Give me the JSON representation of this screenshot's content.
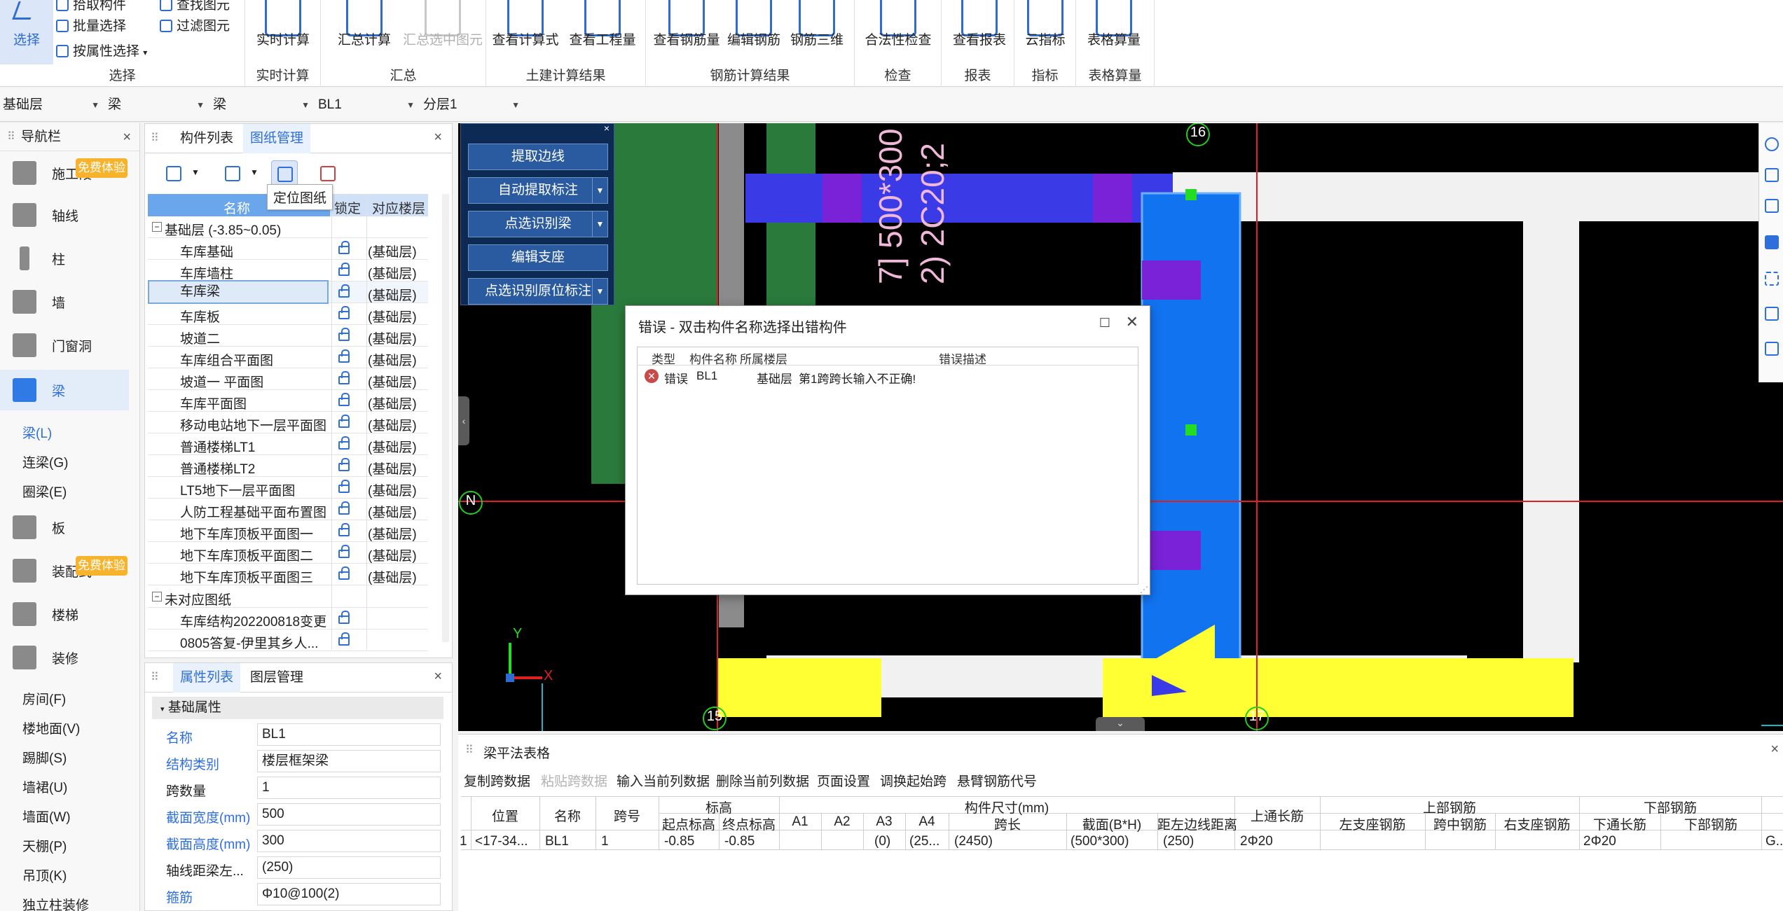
{
  "ribbon": {
    "groups": [
      {
        "title": "选择"
      },
      {
        "title": "实时计算"
      },
      {
        "title": "汇总"
      },
      {
        "title": "土建计算结果"
      },
      {
        "title": "钢筋计算结果"
      },
      {
        "title": "检查"
      },
      {
        "title": "报表"
      },
      {
        "title": "指标"
      },
      {
        "title": "表格算量"
      }
    ],
    "select_btn": "选择",
    "pick_label": "拾取构件",
    "batch_select": "批量选择",
    "attr_select": "按属性选择",
    "find_element": "查找图元",
    "filter_element": "过滤图元",
    "realtime_calc": "实时计算",
    "sum_calc": "汇总计算",
    "sum_selected": "汇总选中图元",
    "view_formula": "查看计算式",
    "view_quantity": "查看工程量",
    "view_rebar": "查看钢筋量",
    "edit_rebar": "编辑钢筋",
    "rebar_3d": "钢筋三维",
    "legality_check": "合法性检查",
    "view_report": "查看报表",
    "cloud_index": "云指标",
    "table_qty": "表格算量"
  },
  "dropbar": {
    "floor": "基础层",
    "category": "梁",
    "type": "梁",
    "element": "BL1",
    "layer": "分层1"
  },
  "nav": {
    "title": "导航栏",
    "items": [
      {
        "label": "施工段"
      },
      {
        "label": "轴线"
      },
      {
        "label": "柱"
      },
      {
        "label": "墙"
      },
      {
        "label": "门窗洞"
      },
      {
        "label": "梁"
      },
      {
        "label": "板"
      },
      {
        "label": "装配式"
      },
      {
        "label": "楼梯"
      },
      {
        "label": "装修"
      }
    ],
    "beam_subs": [
      "梁(L)",
      "连梁(G)",
      "圈梁(E)"
    ],
    "deco_subs": [
      "房间(F)",
      "楼地面(V)",
      "踢脚(S)",
      "墙裙(U)",
      "墙面(W)",
      "天棚(P)",
      "吊顶(K)",
      "独立柱装修"
    ],
    "trial_badge": "免费体验"
  },
  "drawing_panel": {
    "tab1": "构件列表",
    "tab2": "图纸管理",
    "tooltip": "定位图纸",
    "headers": {
      "name": "名称",
      "lock": "锁定",
      "floor": "对应楼层"
    },
    "group1": "基础层 (-3.85~0.05)",
    "rows": [
      {
        "name": "车库基础",
        "floor": "(基础层)"
      },
      {
        "name": "车库墙柱",
        "floor": "(基础层)"
      },
      {
        "name": "车库梁",
        "floor": "(基础层)"
      },
      {
        "name": "车库板",
        "floor": "(基础层)"
      },
      {
        "name": "坡道二",
        "floor": "(基础层)"
      },
      {
        "name": "车库组合平面图",
        "floor": "(基础层)"
      },
      {
        "name": "坡道一 平面图",
        "floor": "(基础层)"
      },
      {
        "name": "车库平面图",
        "floor": "(基础层)"
      },
      {
        "name": "移动电站地下一层平面图",
        "floor": "(基础层)"
      },
      {
        "name": "普通楼梯LT1",
        "floor": "(基础层)"
      },
      {
        "name": "普通楼梯LT2",
        "floor": "(基础层)"
      },
      {
        "name": "LT5地下一层平面图",
        "floor": "(基础层)"
      },
      {
        "name": "人防工程基础平面布置图",
        "floor": "(基础层)"
      },
      {
        "name": "地下车库顶板平面图一",
        "floor": "(基础层)"
      },
      {
        "name": "地下车库顶板平面图二",
        "floor": "(基础层)"
      },
      {
        "name": "地下车库顶板平面图三",
        "floor": "(基础层)"
      }
    ],
    "group2": "未对应图纸",
    "rows2": [
      {
        "name": "车库结构202200818变更"
      },
      {
        "name": "0805答复-伊里其乡人..."
      }
    ]
  },
  "prop_panel": {
    "tab1": "属性列表",
    "tab2": "图层管理",
    "section": "基础属性",
    "rows": [
      {
        "key": "名称",
        "value": "BL1"
      },
      {
        "key": "结构类别",
        "value": "楼层框架梁"
      },
      {
        "key": "跨数量",
        "value": "1"
      },
      {
        "key": "截面宽度(mm)",
        "value": "500"
      },
      {
        "key": "截面高度(mm)",
        "value": "300"
      },
      {
        "key": "轴线距梁左...",
        "value": "(250)"
      },
      {
        "key": "箍筋",
        "value": "Φ10@100(2)"
      }
    ]
  },
  "recog": {
    "b1": "提取边线",
    "b2": "自动提取标注",
    "b3": "点选识别梁",
    "b4": "编辑支座",
    "b5": "点选识别原位标注"
  },
  "canvas": {
    "axis_16": "16",
    "axis_15": "15",
    "axis_17": "17",
    "axis_n": "N",
    "label_vert1": "7] 500*300",
    "label_vert2": "2) 2C20;2",
    "axis_x": "X",
    "axis_y": "Y"
  },
  "error_dialog": {
    "title": "错误 - 双击构件名称选择出错构件",
    "headers": {
      "type": "类型",
      "name": "构件名称",
      "floor": "所属楼层",
      "desc": "错误描述"
    },
    "row": {
      "type": "错误",
      "name": "BL1",
      "floor": "基础层",
      "desc": "第1跨跨长输入不正确!"
    }
  },
  "beam_table": {
    "title": "梁平法表格",
    "tools": [
      "复制跨数据",
      "粘贴跨数据",
      "输入当前列数据",
      "删除当前列数据",
      "页面设置",
      "调换起始跨",
      "悬臂钢筋代号"
    ],
    "h_pos": "位置",
    "h_name": "名称",
    "h_span": "跨号",
    "h_elev": "标高",
    "h_start_elev": "起点标高",
    "h_end_elev": "终点标高",
    "h_size": "构件尺寸(mm)",
    "h_a1": "A1",
    "h_a2": "A2",
    "h_a3": "A3",
    "h_a4": "A4",
    "h_span_len": "跨长",
    "h_section": "截面(B*H)",
    "h_edge": "距左边线距离",
    "h_top_through": "上通长筋",
    "h_top_rebar": "上部钢筋",
    "h_left_support": "左支座钢筋",
    "h_mid": "跨中钢筋",
    "h_right_support": "右支座钢筋",
    "h_bottom_rebar": "下部钢筋",
    "h_bottom_through": "下通长筋",
    "h_bottom_rebar2": "下部钢筋",
    "row": {
      "idx": "1",
      "pos": "<17-34...",
      "name": "BL1",
      "span": "1",
      "start_elev": "-0.85",
      "end_elev": "-0.85",
      "a3": "(0)",
      "a4": "(25...",
      "span_len": "(2450)",
      "section": "(500*300)",
      "edge": "(250)",
      "top_through": "2Φ20",
      "bottom_through": "2Φ20",
      "last": "G..."
    }
  }
}
